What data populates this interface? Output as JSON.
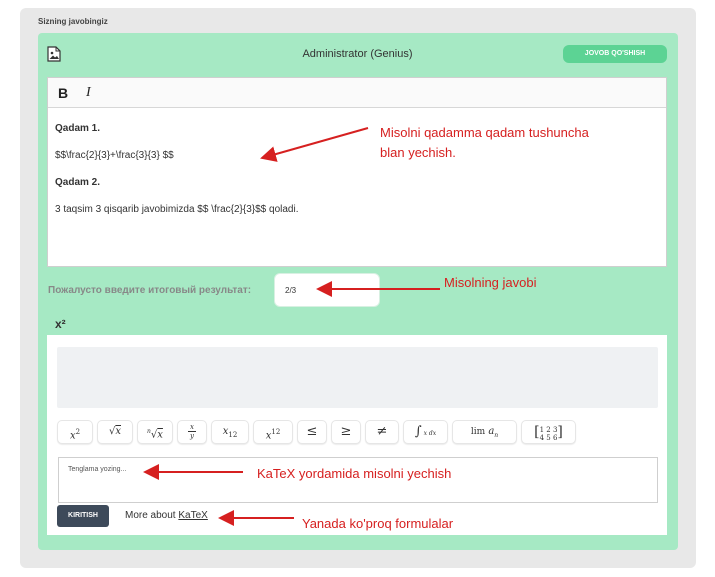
{
  "section_title": "Sizning javobingiz",
  "header": {
    "title": "Administrator  (Genius)",
    "submit_label": "JOVOB QO'SHISH"
  },
  "toolbar": {
    "bold": "B",
    "italic": "I"
  },
  "editor": {
    "lines": [
      "Qadam 1.",
      "$$\\frac{2}{3}+\\frac{3}{3} $$",
      "Qadam 2.",
      "3 taqsim 3 qisqarib javobimizda $$ \\frac{2}{3}$$ qoladi."
    ]
  },
  "result": {
    "label": "Пожалусто введите итоговый результат:",
    "value": "2/3"
  },
  "math_label": "x²",
  "symbols": [
    {
      "label": "x²",
      "icon": "superscript-icon"
    },
    {
      "label": "√x",
      "icon": "sqrt-icon"
    },
    {
      "label": "ⁿ√x",
      "icon": "nth-root-icon"
    },
    {
      "label": "x/y",
      "icon": "fraction-icon"
    },
    {
      "label": "x₁₂",
      "icon": "subscript-icon"
    },
    {
      "label": "x¹²",
      "icon": "power-icon"
    },
    {
      "label": "≤",
      "icon": "leq-icon"
    },
    {
      "label": "≥",
      "icon": "geq-icon"
    },
    {
      "label": "≠",
      "icon": "neq-icon"
    },
    {
      "label": "∫ x dx",
      "icon": "integral-icon"
    },
    {
      "label": "lim aₙ",
      "icon": "limit-icon"
    },
    {
      "label": "[1 2 3; 4 5 6]",
      "icon": "matrix-icon"
    }
  ],
  "latex_input": {
    "placeholder": "Tenglama yozing..."
  },
  "kiritish_label": "KIRITISH",
  "more_text": "More about",
  "more_link": "KaTeX",
  "annotations": {
    "step_by_step_line1": "Misolni qadamma qadam tushuncha",
    "step_by_step_line2": "blan yechish.",
    "answer": "Misolning javobi",
    "katex": "KaTeX yordamida misolni yechish",
    "more_formulas": "Yanada ko'proq formulalar"
  },
  "colors": {
    "card_bg": "#a6e9c4",
    "submit_btn": "#5cd394",
    "annotation": "#d62020",
    "kiritish_btn": "#3d4a5a"
  }
}
